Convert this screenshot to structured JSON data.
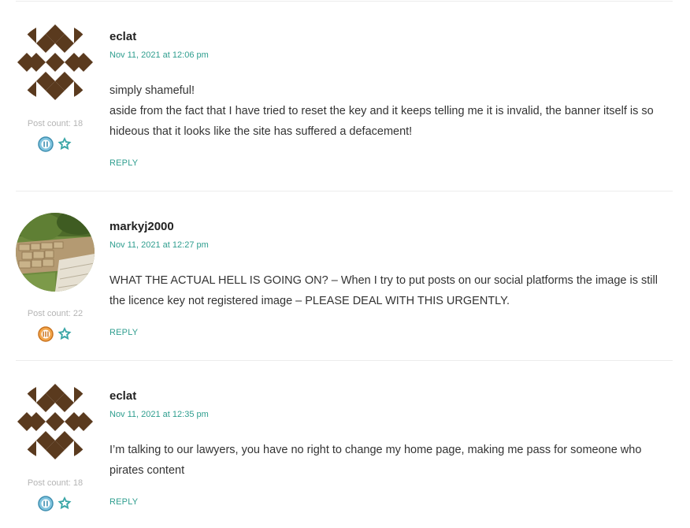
{
  "comments": [
    {
      "author": "eclat",
      "date": "Nov 11, 2021 at 12:06 pm",
      "post_count": "Post count: 18",
      "paragraphs": [
        "simply shameful!",
        "aside from the fact that I have tried to reset the key and it keeps telling me it is invalid, the banner itself is so hideous that it looks like the site has suffered a defacement!"
      ],
      "reply_label": "REPLY",
      "avatar_icon": "geometric-pattern-avatar",
      "badges": [
        "rank-badge-2-icon",
        "star-badge-icon"
      ]
    },
    {
      "author": "markyj2000",
      "date": "Nov 11, 2021 at 12:27 pm",
      "post_count": "Post count: 22",
      "paragraphs": [
        "WHAT THE ACTUAL HELL IS GOING ON? – When I try to put posts on our social platforms the image is still the licence key not registered image – PLEASE DEAL WITH THIS URGENTLY."
      ],
      "reply_label": "REPLY",
      "avatar_icon": "garden-photo-avatar",
      "badges": [
        "rank-badge-3-icon",
        "star-badge-icon"
      ]
    },
    {
      "author": "eclat",
      "date": "Nov 11, 2021 at 12:35 pm",
      "post_count": "Post count: 18",
      "paragraphs": [
        "I’m talking to our lawyers, you have no right to change my home page, making me pass for someone who pirates content"
      ],
      "reply_label": "REPLY",
      "avatar_icon": "geometric-pattern-avatar",
      "badges": [
        "rank-badge-2-icon",
        "star-badge-icon"
      ]
    }
  ],
  "colors": {
    "accent": "#2f9e8f",
    "avatar_pattern": "#5a3a1e",
    "muted": "#b4b4b4"
  }
}
